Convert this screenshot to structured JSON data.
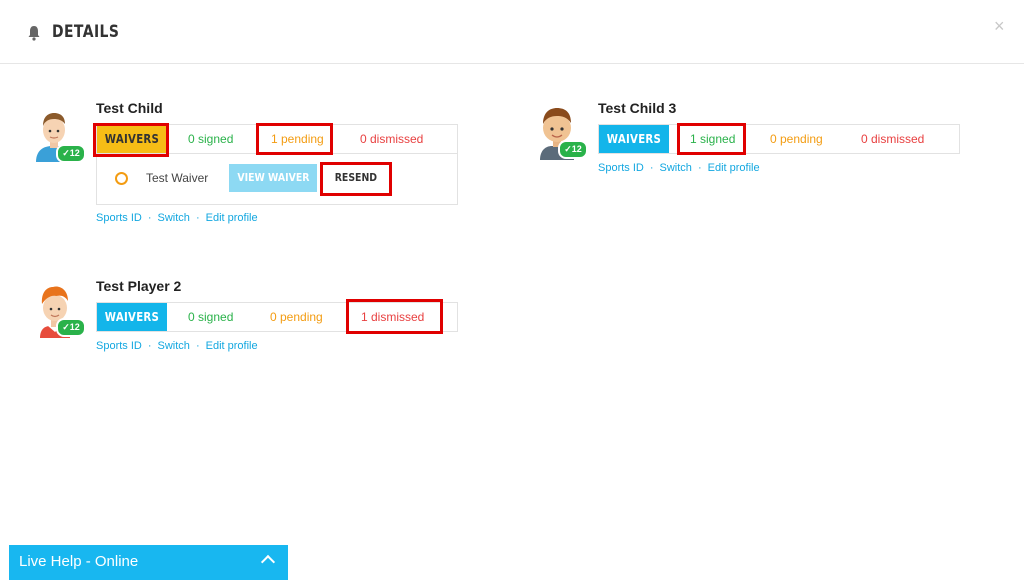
{
  "header": {
    "title": "DETAILS",
    "close_icon": "×"
  },
  "waiver_label": "WAIVERS",
  "players": [
    {
      "name": "Test Child",
      "age": "12",
      "signed": "0 signed",
      "pending": "1 pending",
      "dismissed": "0 dismissed",
      "waiver": {
        "name": "Test Waiver",
        "view_label": "VIEW WAIVER",
        "resend_label": "RESEND"
      }
    },
    {
      "name": "Test Child 3",
      "age": "12",
      "signed": "1 signed",
      "pending": "0 pending",
      "dismissed": "0 dismissed"
    },
    {
      "name": "Test Player 2",
      "age": "12",
      "signed": "0 signed",
      "pending": "0 pending",
      "dismissed": "1 dismissed"
    }
  ],
  "links": {
    "sports_id": "Sports ID",
    "switch": "Switch",
    "edit_profile": "Edit profile",
    "separator": "·"
  },
  "live_help": {
    "label": "Live Help - Online"
  },
  "colors": {
    "accent": "#13b5ea",
    "active": "#f6bd16",
    "signed": "#2ab24a",
    "pending": "#f39c12",
    "dismissed": "#e84040",
    "highlight": "#e00000"
  }
}
